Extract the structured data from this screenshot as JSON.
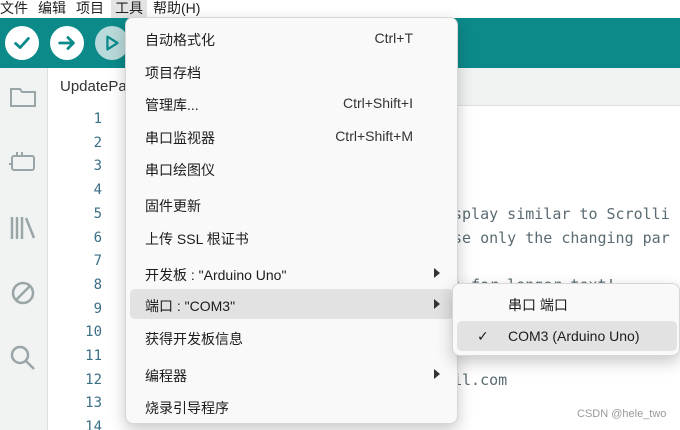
{
  "menubar": {
    "items": [
      {
        "label": "文件"
      },
      {
        "label": "编辑"
      },
      {
        "label": "项目"
      },
      {
        "label": "工具"
      },
      {
        "label": "帮助(H)"
      }
    ]
  },
  "toolbar": {
    "verify_icon": "check-icon",
    "upload_icon": "arrow-right-icon",
    "debug_icon": "debug-icon"
  },
  "sidebar": {
    "icons": [
      "folder-icon",
      "board-icon",
      "library-icon",
      "debug-disabled-icon",
      "search-icon"
    ]
  },
  "editor": {
    "tab_label": "UpdatePa",
    "line_numbers": [
      "1",
      "2",
      "3",
      "4",
      "5",
      "6",
      "7",
      "8",
      "9",
      "10",
      "11",
      "12",
      "13",
      "14"
    ],
    "code_fragments": [
      {
        "line": 5,
        "text": "splay similar to Scrolli"
      },
      {
        "line": 6,
        "text": "se only the changing par"
      },
      {
        "line": 8,
        "text": ") for longer text!"
      },
      {
        "line": 12,
        "text": "il.com"
      }
    ]
  },
  "tools_menu": {
    "items": [
      {
        "label": "自动格式化",
        "shortcut": "Ctrl+T",
        "submenu": false
      },
      {
        "label": "项目存档",
        "shortcut": "",
        "submenu": false
      },
      {
        "label": "管理库...",
        "shortcut": "Ctrl+Shift+I",
        "submenu": false
      },
      {
        "label": "串口监视器",
        "shortcut": "Ctrl+Shift+M",
        "submenu": false
      },
      {
        "label": "串口绘图仪",
        "shortcut": "",
        "submenu": false
      },
      {
        "label": "固件更新",
        "shortcut": "",
        "submenu": false
      },
      {
        "label": "上传 SSL 根证书",
        "shortcut": "",
        "submenu": false
      },
      {
        "label": "开发板 : \"Arduino Uno\"",
        "shortcut": "",
        "submenu": true
      },
      {
        "label": "端口 : \"COM3\"",
        "shortcut": "",
        "submenu": true
      },
      {
        "label": "获得开发板信息",
        "shortcut": "",
        "submenu": false
      },
      {
        "label": "编程器",
        "shortcut": "",
        "submenu": true
      },
      {
        "label": "烧录引导程序",
        "shortcut": "",
        "submenu": false
      }
    ]
  },
  "port_submenu": {
    "items": [
      {
        "label": "串口 端口",
        "checked": false
      },
      {
        "label": "COM3 (Arduino Uno)",
        "checked": true
      }
    ],
    "check_glyph": "✓"
  },
  "watermark": "CSDN @hele_two",
  "colors": {
    "toolbar": "#0c8a8a",
    "menu_bg": "#f9f9f9",
    "highlight": "#e2e2e2"
  }
}
